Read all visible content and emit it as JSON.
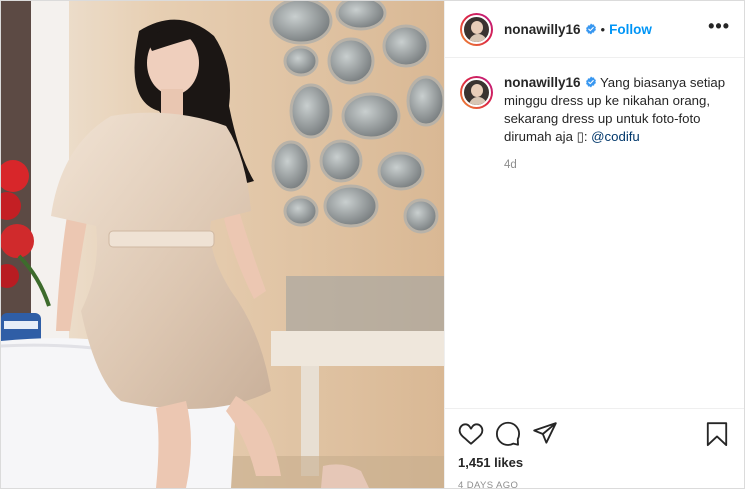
{
  "post": {
    "username": "nonawilly16",
    "follow_label": "Follow",
    "separator": "•",
    "more_label": "•••",
    "caption_prefix": "Yang biasanya setiap minggu dress up ke nikahan orang, sekarang dress up untuk foto-foto dirumah aja ",
    "caption_emoji": "▯",
    "caption_sep": ": ",
    "mention": "@codifu",
    "relative_time": "4d",
    "likes": "1,451 likes",
    "date": "4 DAYS AGO"
  },
  "icons": [
    "heart-icon",
    "comment-icon",
    "share-icon",
    "bookmark-icon",
    "verified-badge-icon",
    "more-options-icon"
  ],
  "colors": {
    "accent": "#0095f6",
    "mention": "#00376b",
    "text": "#262626",
    "muted": "#8e8e8e",
    "border": "#dbdbdb"
  }
}
